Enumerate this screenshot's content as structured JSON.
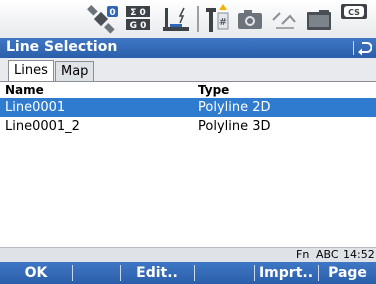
{
  "colors": {
    "title_bar": "#2f66b3",
    "selection": "#2f7bd0",
    "softkey_bar": "#2f66b3"
  },
  "status_icons": [
    "satellite-rtk-icon",
    "position-quality-icon",
    "height-pole-icon",
    "prism-target-icon",
    "camera-icon",
    "line-tool-icon",
    "battery-icon",
    "memory-card-icon"
  ],
  "status": {
    "sat_count": "0",
    "pos_top": "Σ 0",
    "pos_bottom": "G 0",
    "card_label": "CS"
  },
  "title": "Line Selection",
  "tabs": [
    {
      "label": "Lines",
      "active": true
    },
    {
      "label": "Map",
      "active": false
    }
  ],
  "table": {
    "columns": [
      "Name",
      "Type"
    ],
    "rows": [
      {
        "name": "Line0001",
        "type": "Polyline 2D",
        "selected": true
      },
      {
        "name": "Line0001_2",
        "type": "Polyline 3D",
        "selected": false
      }
    ]
  },
  "info": {
    "fn": "Fn",
    "mode": "ABC",
    "time": "14:52"
  },
  "softkeys": [
    "OK",
    "Edit..",
    "Imprt..",
    "Page"
  ]
}
